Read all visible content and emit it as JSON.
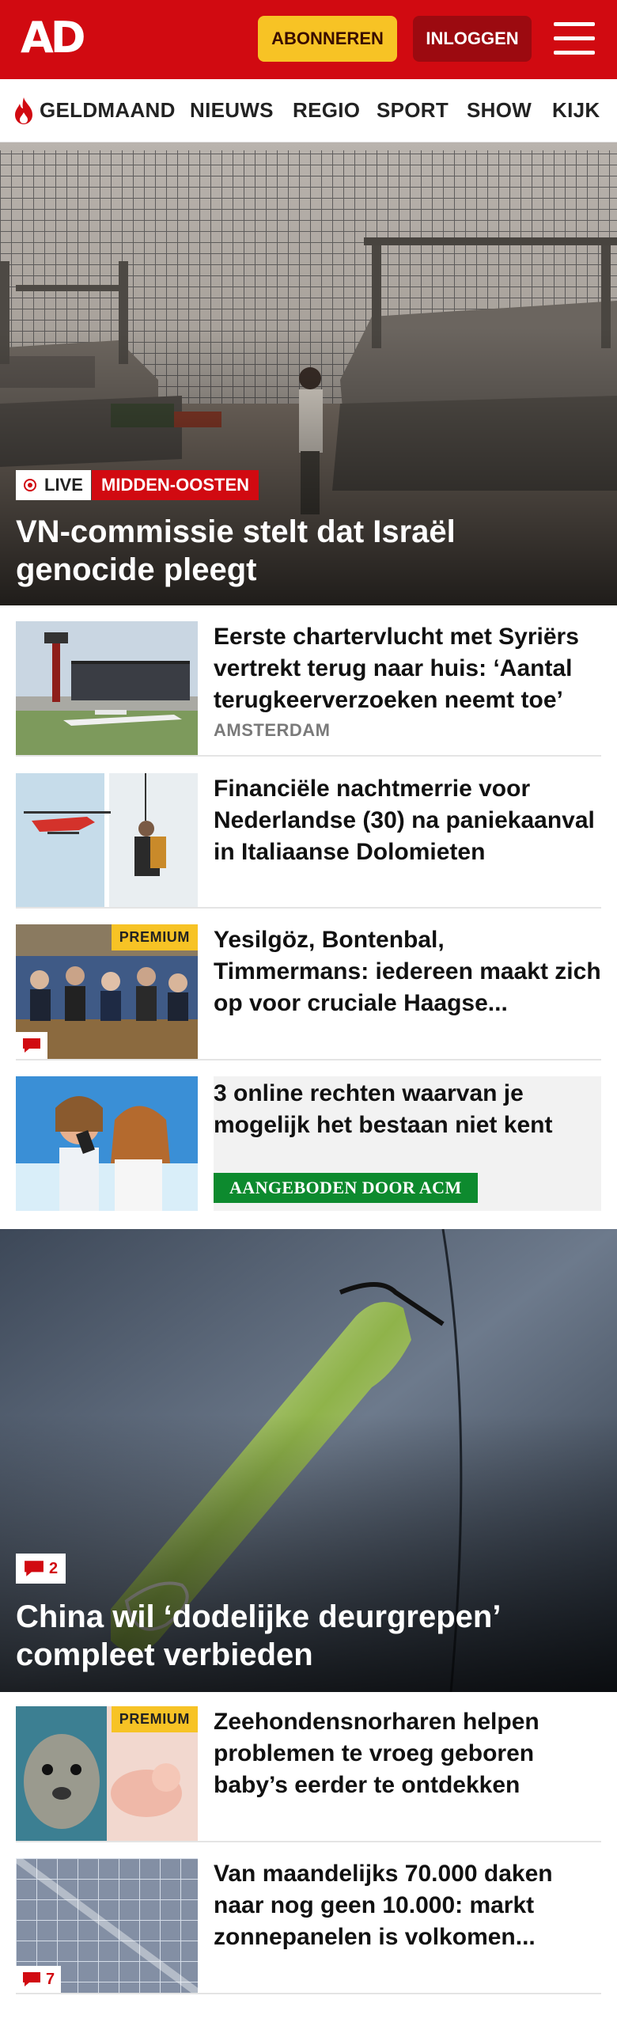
{
  "header": {
    "logo": "AD",
    "subscribe_label": "ABONNEREN",
    "login_label": "INLOGGEN"
  },
  "nav": {
    "items": [
      "GELDMAAND",
      "NIEUWS",
      "REGIO",
      "SPORT",
      "SHOW",
      "KIJK"
    ]
  },
  "hero1": {
    "live_label": "LIVE",
    "category": "MIDDEN-OOSTEN",
    "title": "VN-commissie stelt dat Israël genocide pleegt"
  },
  "articles": [
    {
      "title": "Eerste chartervlucht met Syriërs vertrekt terug naar huis: ‘Aantal terugkeerverzoeken neemt toe’",
      "meta": "AMSTERDAM"
    },
    {
      "title": "Financiële nachtmerrie voor Nederlandse (30) na paniekaanval in Italiaanse Dolomieten"
    },
    {
      "title": "Yesilgöz, Bontenbal, Timmermans: iedereen maakt zich op voor cruciale Haagse...",
      "premium": "PREMIUM"
    },
    {
      "title": "3 online rechten waarvan je mogelijk het bestaan niet kent",
      "sponsor": "AANGEBODEN DOOR ACM"
    }
  ],
  "hero2": {
    "comments": "2",
    "title": "China wil ‘dodelijke deurgrepen’ compleet verbieden"
  },
  "articles2": [
    {
      "title": "Zeehondensnorharen helpen problemen te vroeg geboren baby’s eerder te ontdekken",
      "premium": "PREMIUM"
    },
    {
      "title": "Van maandelijks 70.000 daken naar nog geen 10.000: markt zonnepanelen is volkomen...",
      "comments": "7"
    }
  ],
  "colors": {
    "brand_red": "#d10a11",
    "subscribe_yellow": "#f7c325",
    "login_dark_red": "#9c0a10",
    "sponsor_green": "#0d8a2e"
  },
  "icons": [
    "hamburger-menu-icon",
    "flame-icon",
    "live-dot-icon",
    "comment-icon"
  ]
}
